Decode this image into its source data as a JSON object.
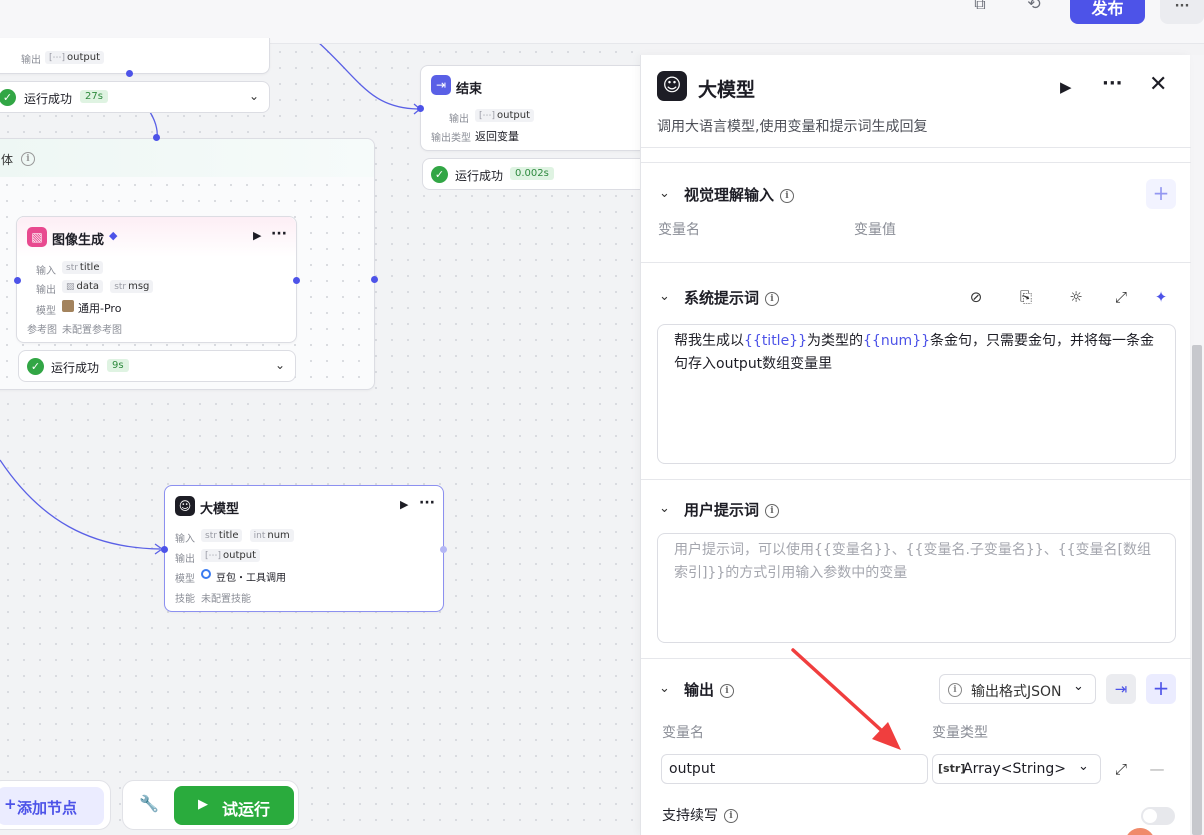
{
  "header": {
    "publish_label": "发布",
    "more_label": "···"
  },
  "canvas": {
    "node_top_partial": {
      "output_label": "输出",
      "output_value": "output",
      "status_text": "运行成功",
      "time": "27s"
    },
    "loop_body": {
      "title": "体"
    },
    "end_node": {
      "title": "结束",
      "output_label": "输出",
      "output_value": "output",
      "output_type_label": "输出类型",
      "output_type_value": "返回变量",
      "status_text": "运行成功",
      "time": "0.002s"
    },
    "image_node": {
      "title": "图像生成",
      "input_label": "输入",
      "input_tags": [
        "title"
      ],
      "output_label": "输出",
      "output_tags": [
        "data",
        "msg"
      ],
      "model_label": "模型",
      "model_value": "通用-Pro",
      "ref_label": "参考图",
      "ref_value": "未配置参考图",
      "status_text": "运行成功",
      "time": "9s"
    },
    "llm_node": {
      "title": "大模型",
      "input_label": "输入",
      "input_tags": [
        "title",
        "num"
      ],
      "output_label": "输出",
      "output_value": "output",
      "model_label": "模型",
      "model_value": "豆包・工具调用",
      "skill_label": "技能",
      "skill_value": "未配置技能"
    },
    "type_str": "str",
    "type_int": "int",
    "add_node_label": "添加节点",
    "run_label": "试运行"
  },
  "panel": {
    "title": "大模型",
    "description": "调用大语言模型,使用变量和提示词生成回复",
    "vision": {
      "title": "视觉理解输入",
      "col_name": "变量名",
      "col_value": "变量值"
    },
    "system_prompt": {
      "title": "系统提示词",
      "text_1": "帮我生成以",
      "var_1": "{{title}}",
      "text_2": "为类型的",
      "var_2": "{{num}}",
      "text_3": "条金句，只需要金句，并将每一条金句存入output数组变量里"
    },
    "user_prompt": {
      "title": "用户提示词",
      "placeholder": "用户提示词，可以使用{{变量名}}、{{变量名.子变量名}}、{{变量名[数组索引]}}的方式引用输入参数中的变量"
    },
    "output": {
      "title": "输出",
      "format_label": "输出格式JSON",
      "col_name": "变量名",
      "col_type": "变量类型",
      "var_name": "output",
      "var_type_prefix": "[str]",
      "var_type": "Array<String>",
      "continue_label": "支持续写"
    }
  },
  "colors": {
    "accent": "#4d53e8",
    "success": "#32a645",
    "arrow": "#f03e3e"
  }
}
